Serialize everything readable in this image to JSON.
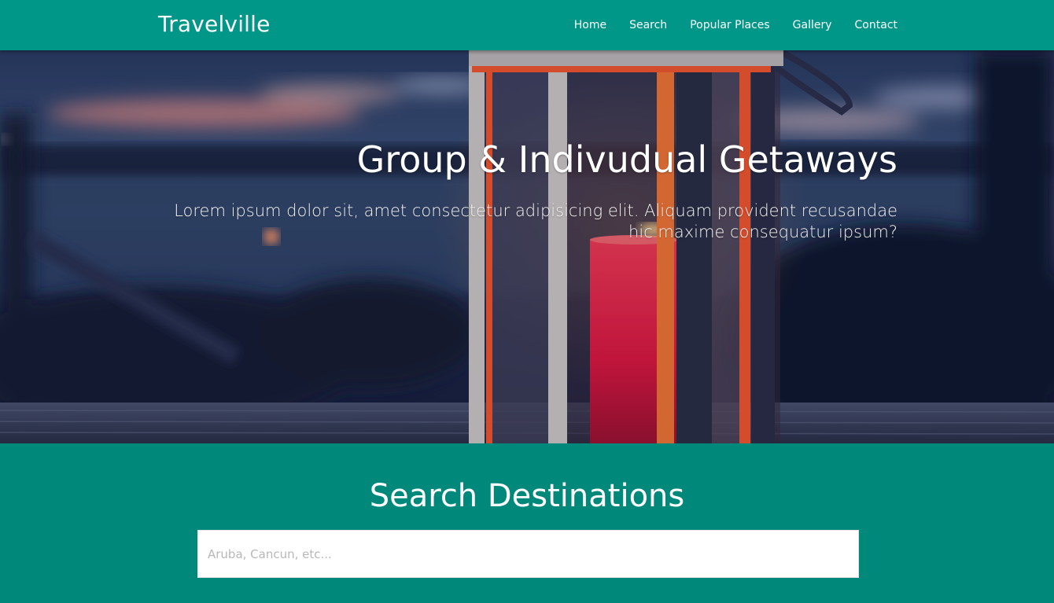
{
  "navbar": {
    "brand": "Travelville",
    "links": [
      "Home",
      "Search",
      "Popular Places",
      "Gallery",
      "Contact"
    ]
  },
  "hero": {
    "title": "Group & Indivudual Getaways",
    "subtitle": "Lorem ipsum dolor sit, amet consectetur adipisicing elit. Aliquam provident recusandae hic maxime consequatur ipsum?"
  },
  "search": {
    "title": "Search Destinations",
    "placeholder": "Aruba, Cancun, etc..."
  },
  "colors": {
    "navbar": "#009688",
    "section": "#00897b",
    "text": "#ffffff"
  }
}
